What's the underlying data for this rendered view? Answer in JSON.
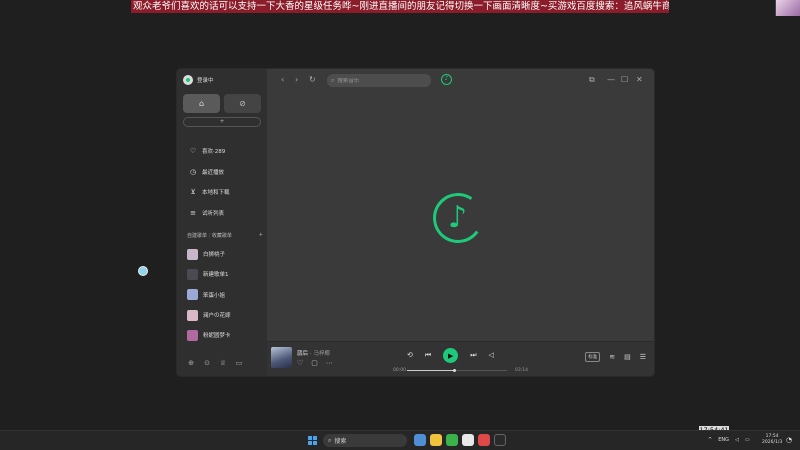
{
  "stream": {
    "banner": "观众老爷们喜欢的话可以支持一下大香的星级任务哗~刚进直播间的朋友记得切换一下画面清晰度~买游戏百度搜索：追风蜗牛商城",
    "clock": "17:54:41"
  },
  "sidebar": {
    "user_name": "登录中",
    "add_label": "+",
    "menu": [
      {
        "icon": "heart-icon",
        "glyph": "♡",
        "label": "喜欢·289"
      },
      {
        "icon": "history-icon",
        "glyph": "◷",
        "label": "最近播放"
      },
      {
        "icon": "download-icon",
        "glyph": "⊻",
        "label": "本地和下载"
      },
      {
        "icon": "list-icon",
        "glyph": "≡",
        "label": "试听列表"
      }
    ],
    "playlist_tabs": {
      "created": "自建歌单",
      "separator": "/",
      "collected": "收藏歌单",
      "add": "+"
    },
    "playlists": [
      {
        "label": "白狮桃子",
        "color": "#c8b7c9"
      },
      {
        "label": "新建歌单1",
        "color": "#4a4a52"
      },
      {
        "label": "笨蛋小姐",
        "color": "#9aa9d6"
      },
      {
        "label": "澜户の花嫁",
        "color": "#d9b9c9"
      },
      {
        "label": "粉妮圆梦卡",
        "color": "#b06aa0"
      }
    ]
  },
  "topbar": {
    "search_placeholder": "搜索音乐"
  },
  "player": {
    "song_title": "鹊后",
    "artist": "· 马梓椰",
    "time_current": "00:00",
    "time_total": "03:14",
    "progress": 0.47,
    "quality_label": "标准"
  },
  "taskbar": {
    "search_label": "搜索",
    "lang": "ENG",
    "time": "17:54",
    "date": "2026/1/3",
    "apps": [
      "#4e8fd6",
      "#f0c43c",
      "#3cb34a",
      "#e8e8e8",
      "#e04848",
      "#2a2a2a"
    ]
  },
  "colors": {
    "accent": "#1ec97a",
    "banner": "#8b1c2a"
  }
}
